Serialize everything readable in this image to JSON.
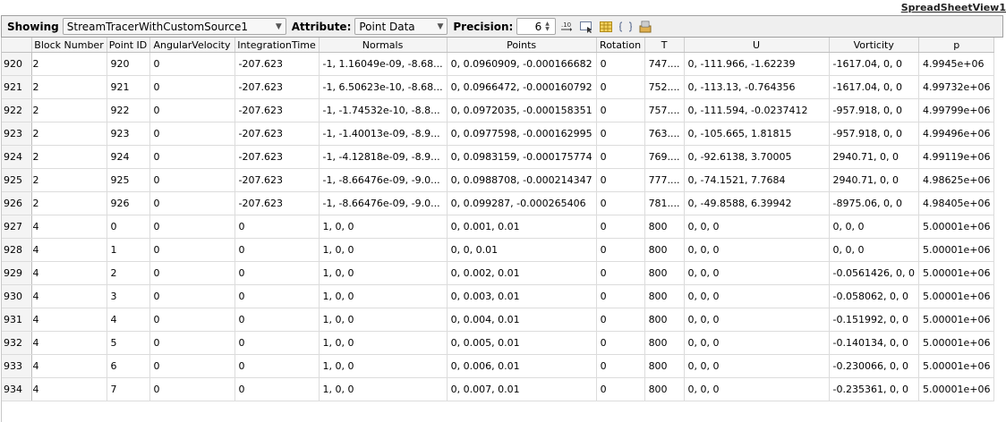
{
  "window": {
    "view_title": "SpreadSheetView1"
  },
  "toolbar": {
    "showing_label": "Showing",
    "source": "StreamTracerWithCustomSource1",
    "attribute_label": "Attribute:",
    "attribute": "Point Data",
    "precision_label": "Precision:",
    "precision": "6",
    "fixed_notation_icon": "fixed-notation-icon",
    "select_cells_icon": "select-cells-icon",
    "toggle_columns_icon": "toggle-columns-icon",
    "cell_connectivity_icon": "cell-connectivity-icon",
    "export_icon": "export-icon"
  },
  "colors": {
    "toolbar_bg": "#efefef",
    "header_bg": "#f4f4f4",
    "grid": "#dcdcdc"
  },
  "table": {
    "columns": [
      "Block Number",
      "Point ID",
      "AngularVelocity",
      "IntegrationTime",
      "Normals",
      "Points",
      "Rotation",
      "T",
      "U",
      "Vorticity",
      "p"
    ],
    "rows": [
      {
        "id": "920",
        "cells": [
          "2",
          "920",
          "0",
          "-207.623",
          "-1, 1.16049e-09, -8.68...",
          "0, 0.0960909, -0.000166682",
          "0",
          "747....",
          "0, -111.966, -1.62239",
          "-1617.04, 0, 0",
          "4.9945e+06"
        ]
      },
      {
        "id": "921",
        "cells": [
          "2",
          "921",
          "0",
          "-207.623",
          "-1, 6.50623e-10, -8.68...",
          "0, 0.0966472, -0.000160792",
          "0",
          "752....",
          "0, -113.13, -0.764356",
          "-1617.04, 0, 0",
          "4.99732e+06"
        ]
      },
      {
        "id": "922",
        "cells": [
          "2",
          "922",
          "0",
          "-207.623",
          "-1, -1.74532e-10, -8.8...",
          "0, 0.0972035, -0.000158351",
          "0",
          "757....",
          "0, -111.594, -0.0237412",
          "-957.918, 0, 0",
          "4.99799e+06"
        ]
      },
      {
        "id": "923",
        "cells": [
          "2",
          "923",
          "0",
          "-207.623",
          "-1, -1.40013e-09, -8.9...",
          "0, 0.0977598, -0.000162995",
          "0",
          "763....",
          "0, -105.665, 1.81815",
          "-957.918, 0, 0",
          "4.99496e+06"
        ]
      },
      {
        "id": "924",
        "cells": [
          "2",
          "924",
          "0",
          "-207.623",
          "-1, -4.12818e-09, -8.9...",
          "0, 0.0983159, -0.000175774",
          "0",
          "769....",
          "0, -92.6138, 3.70005",
          "2940.71, 0, 0",
          "4.99119e+06"
        ]
      },
      {
        "id": "925",
        "cells": [
          "2",
          "925",
          "0",
          "-207.623",
          "-1, -8.66476e-09, -9.0...",
          "0, 0.0988708, -0.000214347",
          "0",
          "777....",
          "0, -74.1521, 7.7684",
          "2940.71, 0, 0",
          "4.98625e+06"
        ]
      },
      {
        "id": "926",
        "cells": [
          "2",
          "926",
          "0",
          "-207.623",
          "-1, -8.66476e-09, -9.0...",
          "0, 0.099287, -0.000265406",
          "0",
          "781....",
          "0, -49.8588, 6.39942",
          "-8975.06, 0, 0",
          "4.98405e+06"
        ]
      },
      {
        "id": "927",
        "cells": [
          "4",
          "0",
          "0",
          "0",
          "1, 0, 0",
          "0, 0.001, 0.01",
          "0",
          "800",
          "0, 0, 0",
          "0, 0, 0",
          "5.00001e+06"
        ]
      },
      {
        "id": "928",
        "cells": [
          "4",
          "1",
          "0",
          "0",
          "1, 0, 0",
          "0, 0, 0.01",
          "0",
          "800",
          "0, 0, 0",
          "0, 0, 0",
          "5.00001e+06"
        ]
      },
      {
        "id": "929",
        "cells": [
          "4",
          "2",
          "0",
          "0",
          "1, 0, 0",
          "0, 0.002, 0.01",
          "0",
          "800",
          "0, 0, 0",
          "-0.0561426, 0, 0",
          "5.00001e+06"
        ]
      },
      {
        "id": "930",
        "cells": [
          "4",
          "3",
          "0",
          "0",
          "1, 0, 0",
          "0, 0.003, 0.01",
          "0",
          "800",
          "0, 0, 0",
          "-0.058062, 0, 0",
          "5.00001e+06"
        ]
      },
      {
        "id": "931",
        "cells": [
          "4",
          "4",
          "0",
          "0",
          "1, 0, 0",
          "0, 0.004, 0.01",
          "0",
          "800",
          "0, 0, 0",
          "-0.151992, 0, 0",
          "5.00001e+06"
        ]
      },
      {
        "id": "932",
        "cells": [
          "4",
          "5",
          "0",
          "0",
          "1, 0, 0",
          "0, 0.005, 0.01",
          "0",
          "800",
          "0, 0, 0",
          "-0.140134, 0, 0",
          "5.00001e+06"
        ]
      },
      {
        "id": "933",
        "cells": [
          "4",
          "6",
          "0",
          "0",
          "1, 0, 0",
          "0, 0.006, 0.01",
          "0",
          "800",
          "0, 0, 0",
          "-0.230066, 0, 0",
          "5.00001e+06"
        ]
      },
      {
        "id": "934",
        "cells": [
          "4",
          "7",
          "0",
          "0",
          "1, 0, 0",
          "0, 0.007, 0.01",
          "0",
          "800",
          "0, 0, 0",
          "-0.235361, 0, 0",
          "5.00001e+06"
        ]
      }
    ]
  }
}
